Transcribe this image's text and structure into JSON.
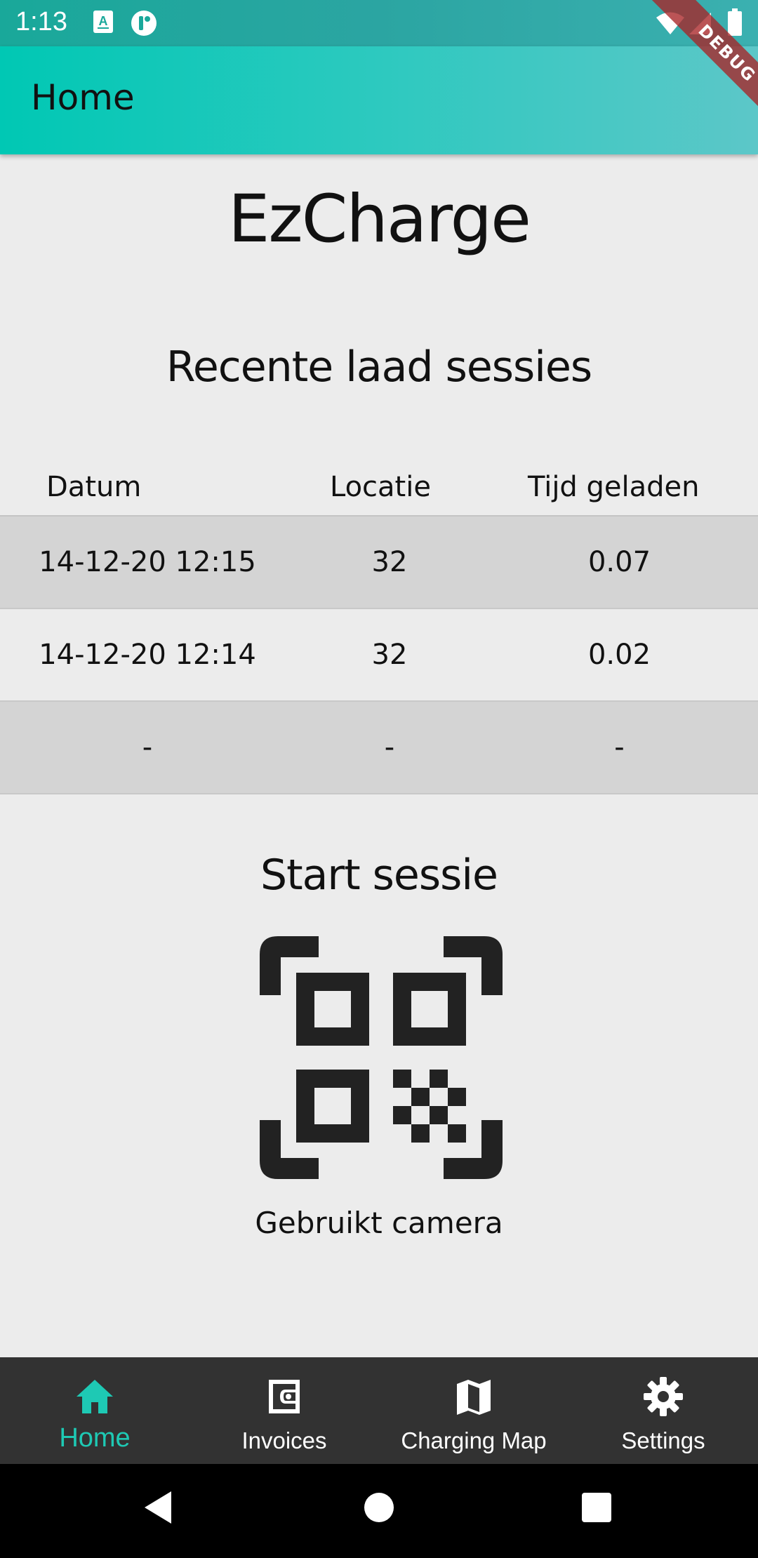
{
  "status_bar": {
    "time": "1:13",
    "icons": [
      "a-notification-icon",
      "circle-app-icon",
      "wifi-icon",
      "signal-icon",
      "battery-icon"
    ]
  },
  "debug_banner": "DEBUG",
  "app_bar": {
    "title": "Home"
  },
  "brand": {
    "title": "EzCharge"
  },
  "sessions": {
    "title": "Recente laad sessies",
    "columns": [
      "Datum",
      "Locatie",
      "Tijd geladen"
    ],
    "rows": [
      [
        "14-12-20 12:15",
        "32",
        "0.07"
      ],
      [
        "14-12-20 12:14",
        "32",
        "0.02"
      ],
      [
        "-",
        "-",
        "-"
      ]
    ]
  },
  "start_session": {
    "title": "Start sessie",
    "icon": "qr-scan-icon",
    "caption": "Gebruikt camera"
  },
  "bottom_nav": {
    "items": [
      {
        "label": "Home",
        "icon": "home-icon",
        "active": true
      },
      {
        "label": "Invoices",
        "icon": "wallet-icon",
        "active": false
      },
      {
        "label": "Charging Map",
        "icon": "map-icon",
        "active": false
      },
      {
        "label": "Settings",
        "icon": "gear-icon",
        "active": false
      }
    ],
    "active_color": "#1ec9b4"
  },
  "colors": {
    "app_bar_gradient_start": "#00c8b4",
    "app_bar_gradient_end": "#5cc7c8",
    "nav_background": "#323232"
  }
}
